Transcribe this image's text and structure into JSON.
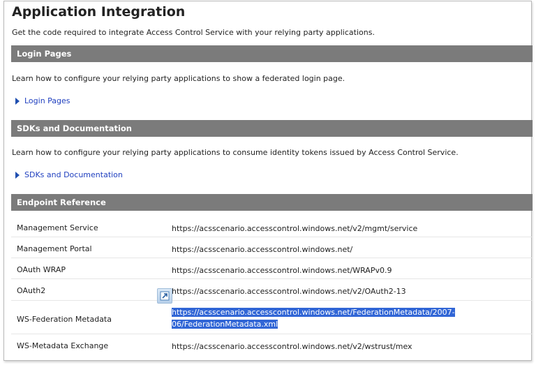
{
  "page": {
    "title": "Application Integration",
    "subtitle": "Get the code required to integrate Access Control Service with your relying party applications."
  },
  "sections": {
    "login": {
      "header": "Login Pages",
      "description": "Learn how to configure your relying party applications to show a federated login page.",
      "link": "Login Pages"
    },
    "sdks": {
      "header": "SDKs and Documentation",
      "description": "Learn how to configure your relying party applications to consume identity tokens issued by Access Control Service.",
      "link": "SDKs and Documentation"
    },
    "endpoints": {
      "header": "Endpoint Reference",
      "rows": [
        {
          "name": "Management Service",
          "url": "https://acsscenario.accesscontrol.windows.net/v2/mgmt/service"
        },
        {
          "name": "Management Portal",
          "url": "https://acsscenario.accesscontrol.windows.net/"
        },
        {
          "name": "OAuth WRAP",
          "url": "https://acsscenario.accesscontrol.windows.net/WRAPv0.9"
        },
        {
          "name": "OAuth2",
          "url": "https://acsscenario.accesscontrol.windows.net/v2/OAuth2-13"
        },
        {
          "name": "WS-Federation Metadata",
          "url_line1": "https://acsscenario.accesscontrol.windows.net/FederationMetadata/2007-",
          "url_line2": "06/FederationMetadata.xml"
        },
        {
          "name": "WS-Metadata Exchange",
          "url": "https://acsscenario.accesscontrol.windows.net/v2/wstrust/mex"
        }
      ]
    }
  },
  "icons": {
    "link_arrow": "triangle-right-icon",
    "copy": "open-link-icon"
  },
  "colors": {
    "header_bg": "#7b7b7b",
    "link": "#1f3fbf",
    "selection": "#3166d6"
  }
}
